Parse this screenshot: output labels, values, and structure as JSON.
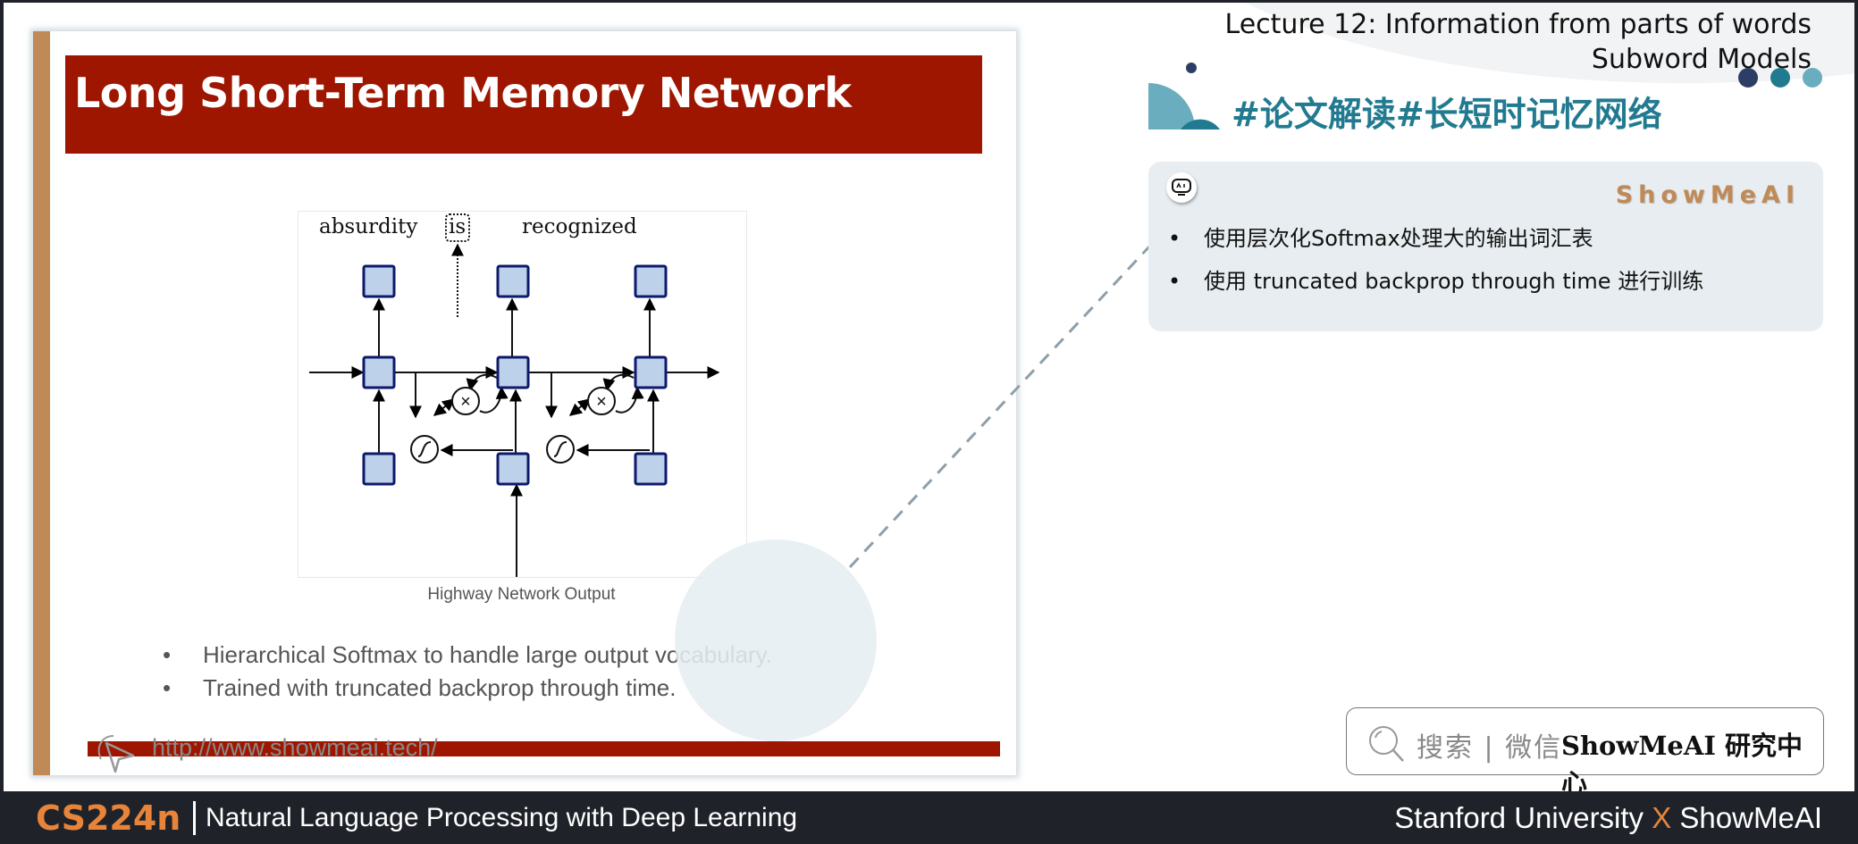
{
  "slide": {
    "title": "Long Short-Term Memory Network",
    "figure": {
      "words": [
        "absurdity",
        "is",
        "recognized"
      ],
      "highlighted_word": "is",
      "caption": "Highway Network Output"
    },
    "bullets": [
      "Hierarchical Softmax to handle large output vocabulary.",
      "Trained with truncated backprop through time."
    ],
    "url": "http://www.showmeai.tech/"
  },
  "header": {
    "lecture_line1": "Lecture 12: Information from parts of words",
    "lecture_line2": "Subword Models",
    "section_title": "#论文解读#长短时记忆网络"
  },
  "card": {
    "brand": "ShowMeAI",
    "icon": "ai-robot-icon",
    "bullets": [
      "使用层次化Softmax处理大的输出词汇表",
      "使用 truncated backprop through time 进行训练"
    ]
  },
  "search": {
    "label": "搜索 | 微信",
    "brand": "ShowMeAI 研究中心"
  },
  "footer": {
    "course": "CS224n",
    "subtitle": "Natural Language Processing with Deep Learning",
    "partner_left": "Stanford University",
    "partner_x": "X",
    "partner_right": "ShowMeAI"
  },
  "colors": {
    "title_red": "#9e1600",
    "accent_tan": "#c08a57",
    "teal": "#217a90",
    "teal_light": "#6aadbf",
    "navy": "#2c3e66",
    "orange": "#e8843a",
    "footer_bg": "#1f2329",
    "node_fill": "#bed1ea",
    "node_stroke": "#0d1a6b"
  }
}
